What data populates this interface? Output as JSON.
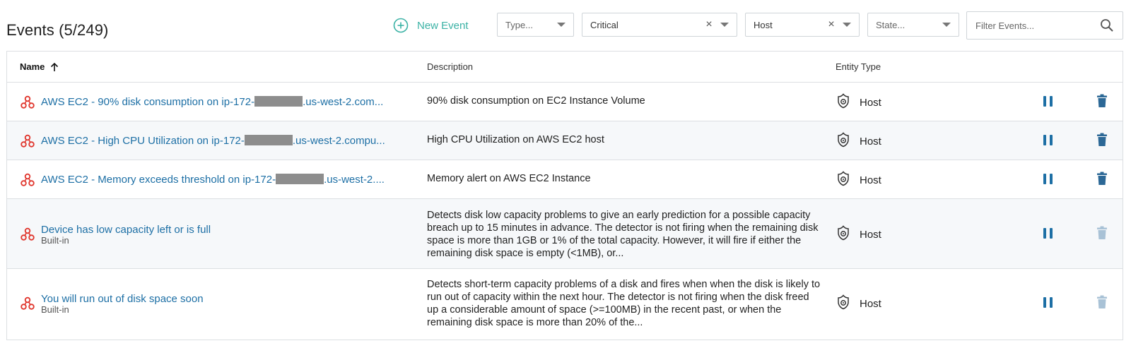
{
  "header": {
    "title": "Events (5/249)",
    "new_event_label": "New Event"
  },
  "filters": {
    "type": {
      "placeholder": "Type..."
    },
    "severity": {
      "value": "Critical"
    },
    "entity": {
      "value": "Host"
    },
    "state": {
      "placeholder": "State..."
    },
    "search": {
      "placeholder": "Filter Events..."
    }
  },
  "table": {
    "columns": {
      "name": "Name",
      "description": "Description",
      "entity_type": "Entity Type"
    },
    "sort": "ascending",
    "rows": [
      {
        "name_pre": "AWS EC2 - 90% disk consumption on ip-172-",
        "name_post": ".us-west-2.com...",
        "redacted": true,
        "builtin": "",
        "description": "90% disk consumption on EC2 Instance Volume",
        "entity_type": "Host",
        "deletable": true
      },
      {
        "name_pre": "AWS EC2 - High CPU Utilization on ip-172-",
        "name_post": ".us-west-2.compu...",
        "redacted": true,
        "builtin": "",
        "description": "High CPU Utilization on AWS EC2 host",
        "entity_type": "Host",
        "deletable": true
      },
      {
        "name_pre": "AWS EC2 - Memory exceeds threshold on ip-172-",
        "name_post": ".us-west-2....",
        "redacted": true,
        "builtin": "",
        "description": "Memory alert on AWS EC2 Instance",
        "entity_type": "Host",
        "deletable": true
      },
      {
        "name_pre": "Device has low capacity left or is full",
        "name_post": "",
        "redacted": false,
        "builtin": "Built-in",
        "description": "Detects disk low capacity problems to give an early prediction for a possible capacity breach up to 15 minutes in advance. The detector is not firing when the remaining disk space is more than 1GB or 1% of the total capacity. However, it will fire if either the remaining disk space is empty (<1MB), or...",
        "entity_type": "Host",
        "deletable": false
      },
      {
        "name_pre": "You will run out of disk space soon",
        "name_post": "",
        "redacted": false,
        "builtin": "Built-in",
        "description": "Detects short-term capacity problems of a disk and fires when when the disk is likely to run out of capacity within the next hour. The detector is not firing when the disk freed up a considerable amount of space (>=100MB) in the recent past, or when the remaining disk space is more than 20% of the...",
        "entity_type": "Host",
        "deletable": false
      }
    ]
  },
  "colors": {
    "accent": "#3bb2a5",
    "link": "#1d6fa5",
    "event_icon": "#e0342b",
    "trash_enabled": "#2c6896",
    "trash_disabled": "#a9c2d6"
  },
  "icons": {
    "new_event": "plus-circle-icon",
    "event": "event-cluster-icon",
    "host": "host-icon",
    "search": "search-icon",
    "sort": "arrow-up-icon",
    "pause": "pause-icon",
    "delete": "trash-icon"
  }
}
